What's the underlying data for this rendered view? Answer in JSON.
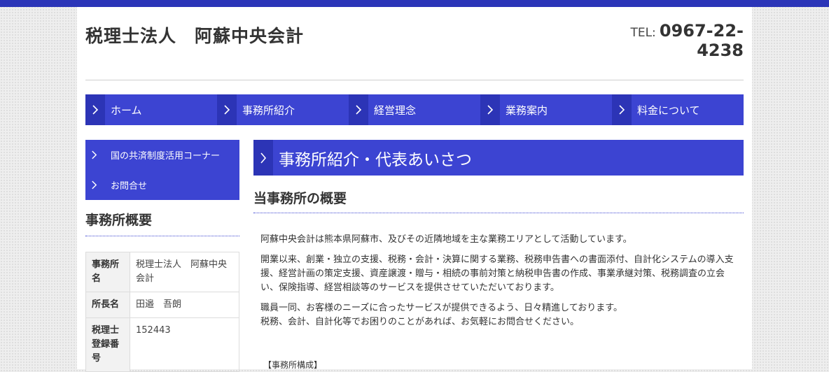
{
  "header": {
    "site_title": "税理士法人　阿蘇中央会計",
    "tel_label": "TEL:",
    "tel_number_line1": "0967-22-",
    "tel_number_line2": "4238"
  },
  "global_nav": {
    "items": [
      {
        "label": "ホーム"
      },
      {
        "label": "事務所紹介"
      },
      {
        "label": "経営理念"
      },
      {
        "label": "業務案内"
      },
      {
        "label": "料金について"
      }
    ]
  },
  "sidebar": {
    "menu": [
      {
        "label": "国の共済制度活用コーナー"
      },
      {
        "label": "お問合せ"
      }
    ],
    "heading": "事務所概要",
    "table": [
      {
        "label": "事務所名",
        "value": "税理士法人　阿蘇中央会計"
      },
      {
        "label": "所長名",
        "value": "田邉　吾朗"
      },
      {
        "label": "税理士登録番号",
        "value": "152443"
      }
    ]
  },
  "main": {
    "page_title": "事務所紹介・代表あいさつ",
    "section_title": "当事務所の概要",
    "paragraphs": [
      "阿蘇中央会計は熊本県阿蘇市、及びその近隣地域を主な業務エリアとして活動しています。",
      "開業以来、創業・独立の支援、税務・会計・決算に関する業務、税務申告書への書面添付、自計化システムの導入支援、経営計画の策定支援、資産譲渡・贈与・相続の事前対策と納税申告書の作成、事業承継対策、税務調査の立会い、保険指導、経営相談等のサービスを提供させていただいております。",
      "職員一同、お客様のニーズに合ったサービスが提供できるよう、日々精進しております。",
      "税務、会計、自計化等でお困りのことがあれば、お気軽にお問合せください。"
    ],
    "composition_label": "【事務所構成】"
  },
  "colors": {
    "accent": "#3c44d2",
    "accent_dark": "#2c34b6",
    "top_bar": "#2b35b8"
  },
  "icons": {
    "nav_chevron": "chevron-right-icon"
  }
}
